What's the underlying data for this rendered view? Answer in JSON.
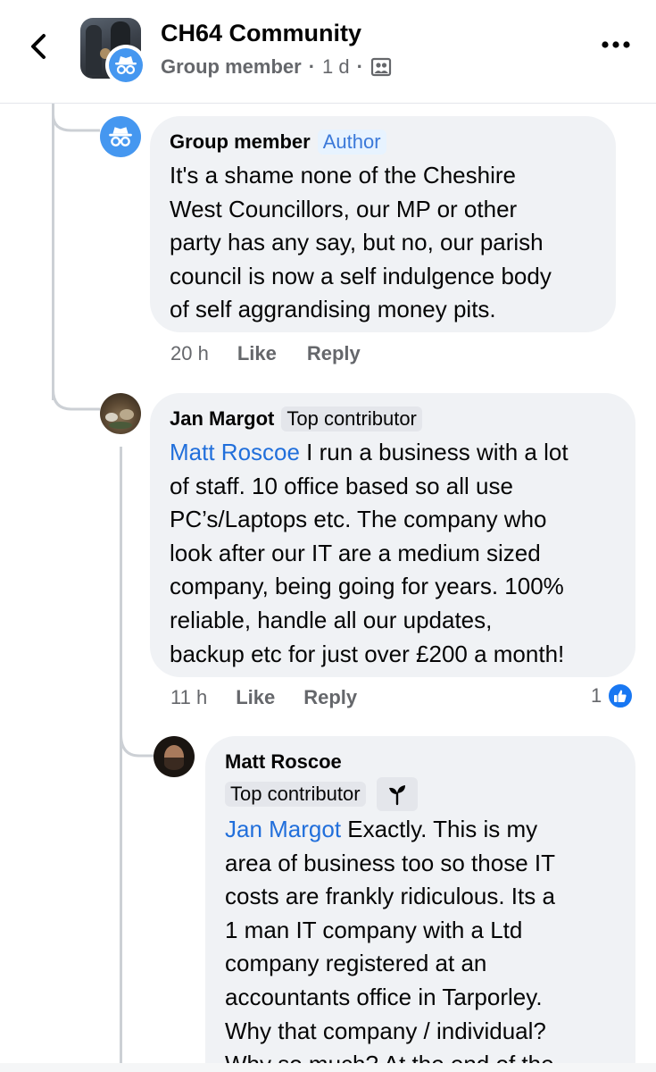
{
  "header": {
    "group_name": "CH64 Community",
    "poster": "Group member",
    "separator": "·",
    "age": "1 d",
    "back_icon": "chevron-left-icon",
    "more_icon": "more-horizontal-icon",
    "audience_icon": "group-audience-icon"
  },
  "comments": [
    {
      "author": "Group member",
      "tag": "Author",
      "avatar_icon": "anonymous-member-icon",
      "lines": [
        "It's a shame none of the Cheshire",
        "West Councillors, our MP or other",
        "party has any say, but no, our parish",
        "council is now a self indulgence body",
        "of self aggrandising money pits."
      ],
      "time": "20 h",
      "like": "Like",
      "reply": "Reply"
    },
    {
      "author": "Jan Margot",
      "tag": "Top contributor",
      "mention": "Matt Roscoe",
      "lines": [
        " I run a business with a lot",
        "of staff. 10 office based so all use",
        "PC’s/Laptops etc.  The company who",
        "look after our IT are a medium sized",
        "company, being going for years. 100%",
        "reliable, handle all our updates,",
        "backup etc for just over £200 a month!"
      ],
      "time": "11 h",
      "like": "Like",
      "reply": "Reply",
      "reaction_count": "1"
    },
    {
      "author": "Matt Roscoe",
      "tag": "Top contributor",
      "badge_icon": "new-member-sprout-icon",
      "mention": "Jan Margot",
      "lines": [
        " Exactly.   This is my",
        "area of business too so those IT",
        "costs are frankly ridiculous.   Its a",
        "1 man IT company with a Ltd",
        "company registered at an",
        "accountants office in Tarporley.",
        "Why that company / individual?",
        "Why so much?   At the end of the"
      ]
    }
  ],
  "colors": {
    "bubble": "#f0f2f5",
    "mention": "#216fdb",
    "author_tag_bg": "#e7f3ff",
    "author_tag_text": "#3b79d9",
    "secondary_text": "#65676b",
    "like_blue": "#1877f2"
  }
}
